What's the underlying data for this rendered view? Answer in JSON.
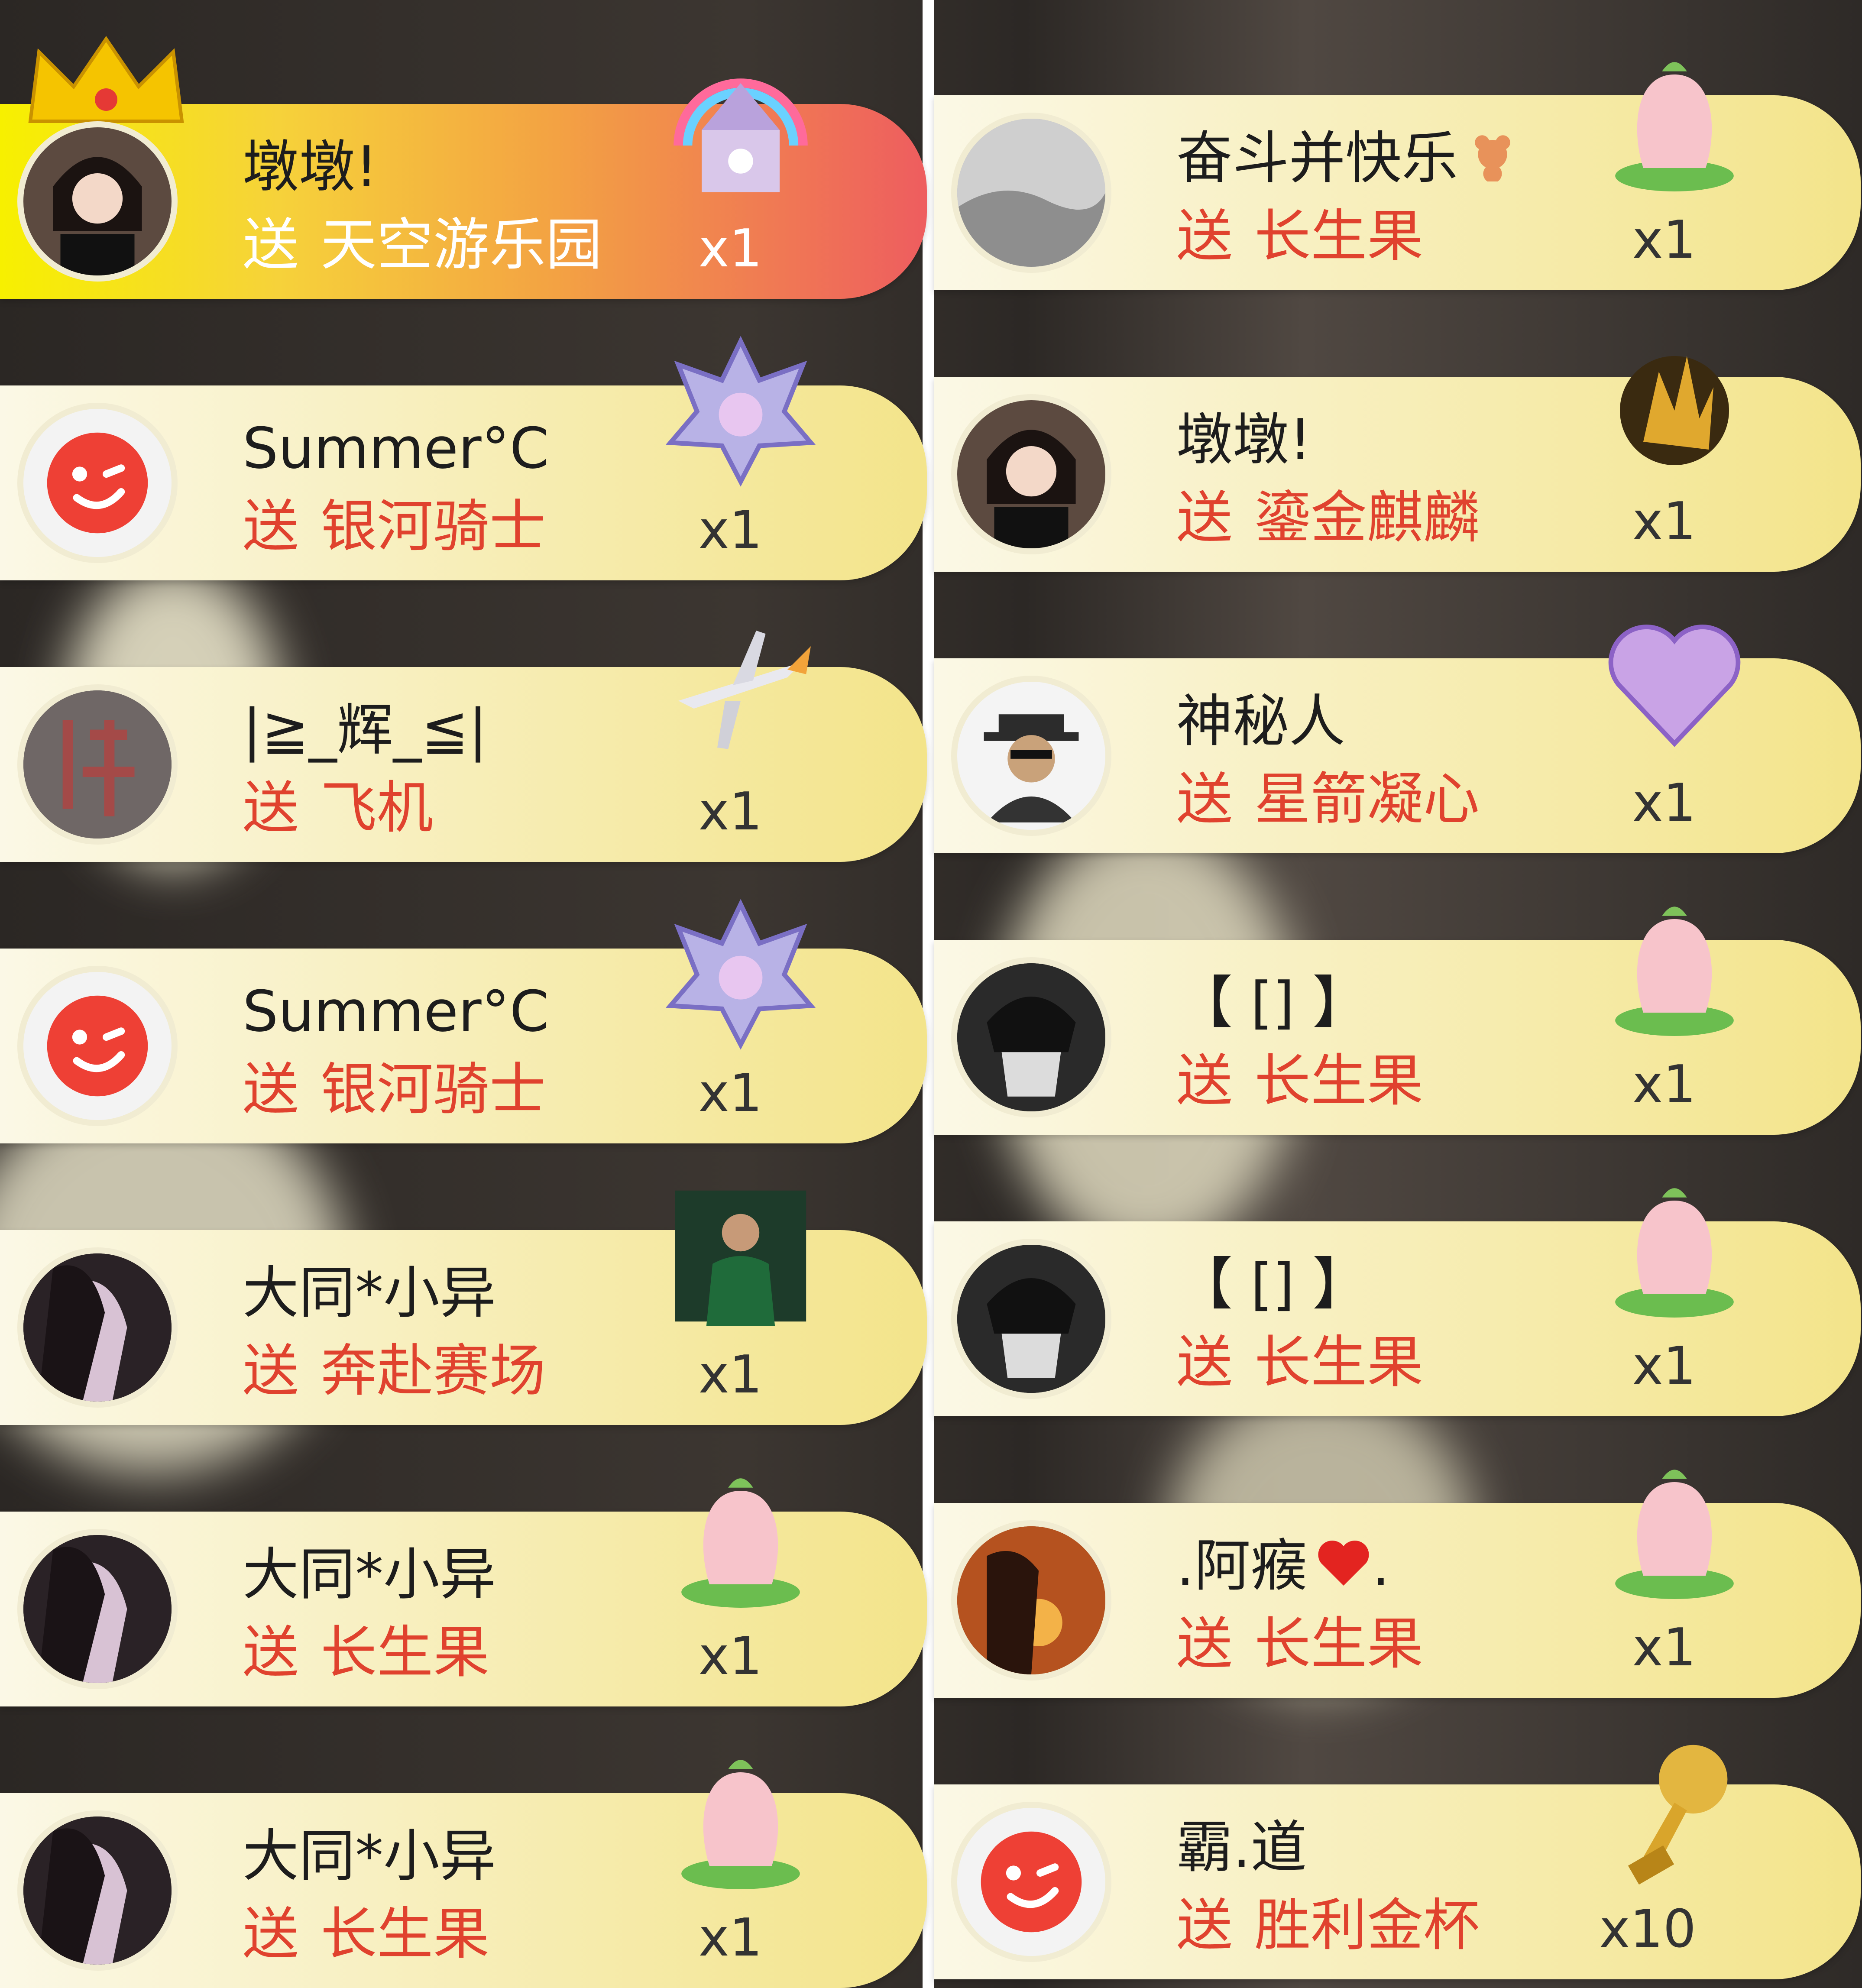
{
  "left_column": [
    {
      "user": "墩墩!",
      "send": "送",
      "gift": "天空游乐园",
      "count": "x1",
      "avatar_icon": "girl-avatar-icon",
      "gift_icon": "sky-amusement-park-icon",
      "crowned": true
    },
    {
      "user": "Summer°C",
      "send": "送",
      "gift": "银河骑士",
      "count": "x1",
      "avatar_icon": "wink-face-avatar-icon",
      "gift_icon": "galaxy-knight-emblem-icon"
    },
    {
      "user": "|≧_辉_≦|",
      "send": "送",
      "gift": "飞机",
      "count": "x1",
      "avatar_icon": "calligraphy-avatar-icon",
      "gift_icon": "airplane-icon"
    },
    {
      "user": "Summer°C",
      "send": "送",
      "gift": "银河骑士",
      "count": "x1",
      "avatar_icon": "wink-face-avatar-icon",
      "gift_icon": "galaxy-knight-emblem-icon"
    },
    {
      "user": "大同*小异",
      "send": "送",
      "gift": "奔赴赛场",
      "count": "x1",
      "avatar_icon": "woman-avatar-icon",
      "gift_icon": "soccer-player-icon"
    },
    {
      "user": "大同*小异",
      "send": "送",
      "gift": "长生果",
      "count": "x1",
      "avatar_icon": "woman-avatar-icon",
      "gift_icon": "peach-fruit-icon"
    },
    {
      "user": "大同*小异",
      "send": "送",
      "gift": "长生果",
      "count": "x1",
      "avatar_icon": "woman-avatar-icon",
      "gift_icon": "peach-fruit-icon"
    }
  ],
  "right_column": [
    {
      "user": "奋斗并快乐",
      "send": "送",
      "gift": "长生果",
      "count": "x1",
      "avatar_icon": "cloud-avatar-icon",
      "gift_icon": "peach-fruit-icon",
      "badge_icon": "bear-badge-icon"
    },
    {
      "user": "墩墩!",
      "send": "送",
      "gift": "鎏金麒麟",
      "count": "x1",
      "avatar_icon": "girl-avatar-icon",
      "gift_icon": "golden-kirin-icon"
    },
    {
      "user": "神秘人",
      "send": "送",
      "gift": "星箭凝心",
      "count": "x1",
      "avatar_icon": "mystery-man-avatar-icon",
      "gift_icon": "heart-crystal-icon"
    },
    {
      "user": "【 [] 】",
      "send": "送",
      "gift": "长生果",
      "count": "x1",
      "avatar_icon": "masked-boy-avatar-icon",
      "gift_icon": "peach-fruit-icon"
    },
    {
      "user": "【 [] 】",
      "send": "送",
      "gift": "长生果",
      "count": "x1",
      "avatar_icon": "masked-boy-avatar-icon",
      "gift_icon": "peach-fruit-icon"
    },
    {
      "user": ".阿瘊",
      "user_suffix": ".",
      "send": "送",
      "gift": "长生果",
      "count": "x1",
      "avatar_icon": "sunset-avatar-icon",
      "gift_icon": "peach-fruit-icon",
      "badge_icon": "red-heart-icon"
    },
    {
      "user": "霸.道",
      "send": "送",
      "gift": "胜利金杯",
      "count": "x10",
      "avatar_icon": "wink-face-avatar-icon",
      "gift_icon": "golden-trophy-icon"
    }
  ],
  "colors": {
    "gift_text": "#e0422e",
    "card_start": "#fbf8e6",
    "card_end": "#f3e48a",
    "crown": "#f5c400"
  }
}
